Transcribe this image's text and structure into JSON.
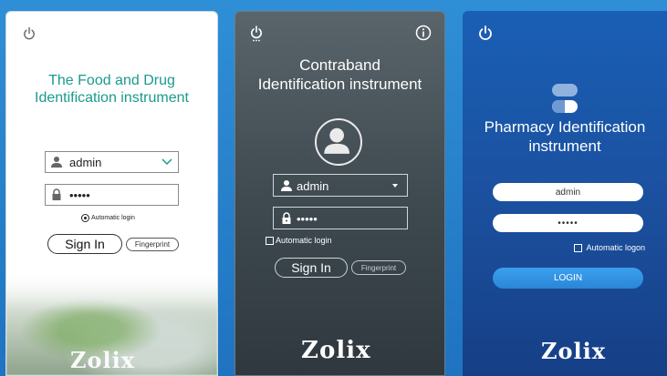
{
  "panel_food": {
    "title_line1": "The Food and Drug",
    "title_line2": "Identification instrument",
    "username": "admin",
    "password_mask": "•••••",
    "auto_login": "Automatic login",
    "sign_in": "Sign In",
    "fingerprint": "Fingerprint",
    "logo": "Zolix",
    "icons": [
      "power-icon",
      "user-icon",
      "lock-icon",
      "chevron-down-icon",
      "radio-icon"
    ],
    "colors": {
      "title": "#1a9a8c",
      "background": "#ffffff"
    }
  },
  "panel_contraband": {
    "title_line1": "Contraband",
    "title_line2": "Identification instrument",
    "username": "admin",
    "password_mask": "•••••",
    "auto_login": "Automatic login",
    "sign_in": "Sign In",
    "fingerprint": "Fingerprint",
    "logo": "Zolix",
    "icons": [
      "power-icon",
      "info-icon",
      "avatar-icon",
      "user-icon",
      "lock-icon",
      "dropdown-caret-icon",
      "checkbox-icon"
    ],
    "colors": {
      "background": "#3f4a51",
      "text": "#ffffff"
    }
  },
  "panel_pharmacy": {
    "title_line1": "Pharmacy Identification",
    "title_line2": "instrument",
    "username": "admin",
    "password_mask": "•••••",
    "auto_logon": "Automatic logon",
    "login": "LOGIN",
    "logo": "Zolix",
    "icons": [
      "power-icon",
      "pill-icon",
      "checkbox-icon"
    ],
    "colors": {
      "background": "#1b4f9d",
      "button": "#2a86d6"
    }
  }
}
